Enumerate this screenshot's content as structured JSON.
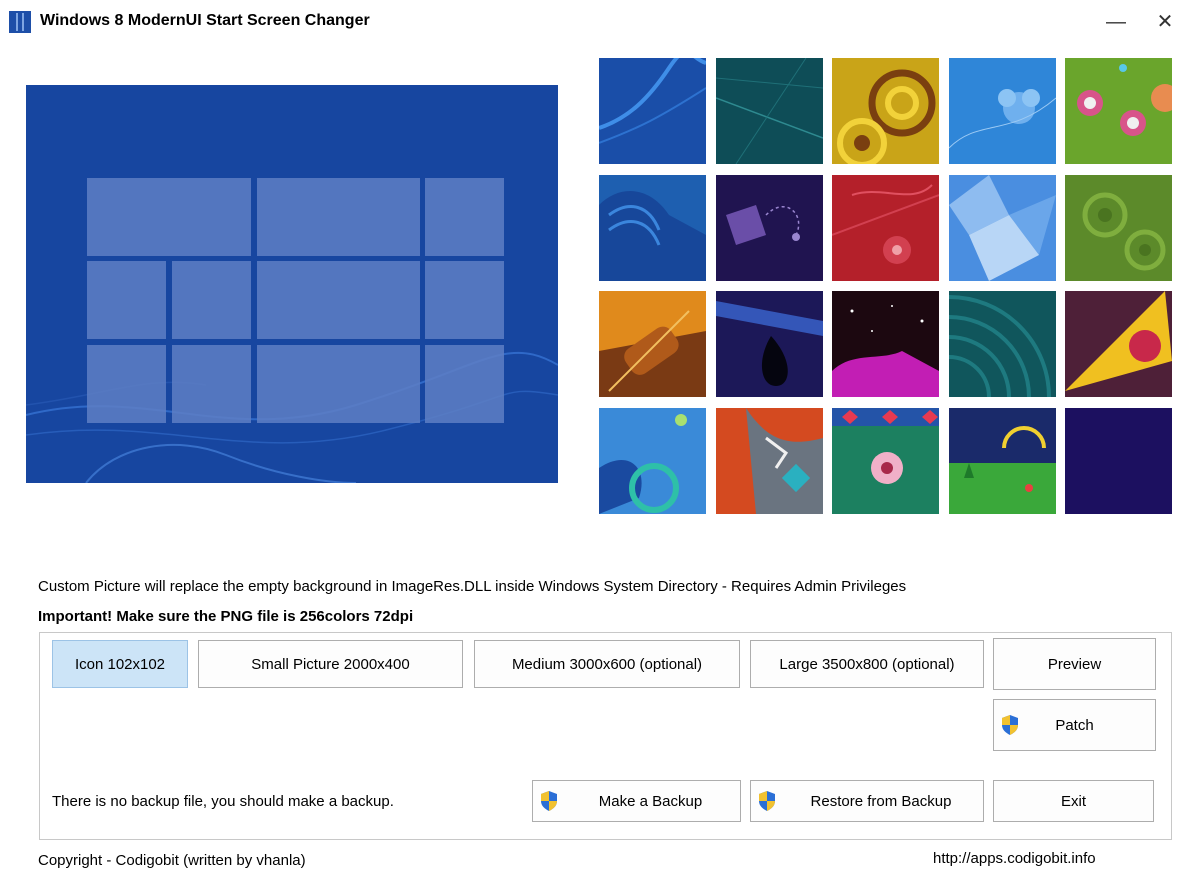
{
  "window": {
    "title": "Windows 8 ModernUI Start Screen Changer",
    "minimize_glyph": "—",
    "close_glyph": "✕"
  },
  "info": {
    "line1": "Custom Picture will replace the empty background in ImageRes.DLL inside Windows System Directory - Requires Admin Privileges",
    "line2": "Important! Make sure the PNG file is 256colors 72dpi"
  },
  "tabs": {
    "icon": "Icon 102x102",
    "small": "Small Picture 2000x400",
    "medium": "Medium 3000x600 (optional)",
    "large": "Large 3500x800 (optional)"
  },
  "actions": {
    "preview": "Preview",
    "patch": "Patch",
    "backup": "Make a Backup",
    "restore": "Restore from Backup",
    "exit": "Exit"
  },
  "status": "There is no backup file, you should make a backup.",
  "footer": {
    "copyright": "Copyright - Codigobit (written by vhanla)",
    "url": "http://apps.codigobit.info"
  },
  "colors": {
    "preview_bg": "#1746a0",
    "selected_tab": "#cce4f7",
    "shield_blue": "#2b6fd6",
    "shield_yellow": "#f2c230"
  },
  "icons": {
    "app": "app-icon",
    "shield": "uac-shield-icon"
  }
}
